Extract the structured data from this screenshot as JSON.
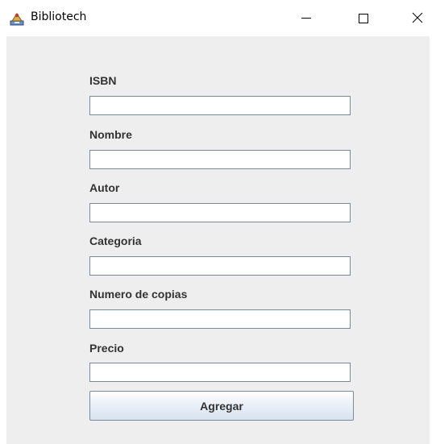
{
  "window": {
    "title": "Bibliotech",
    "icons": {
      "app": "java-app-icon",
      "minimize": "minimize-icon",
      "maximize": "maximize-icon",
      "close": "close-icon"
    }
  },
  "form": {
    "fields": [
      {
        "label": "ISBN",
        "value": ""
      },
      {
        "label": "Nombre",
        "value": ""
      },
      {
        "label": "Autor",
        "value": ""
      },
      {
        "label": "Categoria",
        "value": ""
      },
      {
        "label": "Numero de copias",
        "value": ""
      },
      {
        "label": "Precio",
        "value": ""
      }
    ],
    "submit_label": "Agregar"
  },
  "colors": {
    "panel_background": "#eeeeee",
    "label_text": "#333333",
    "field_border": "#7a8a99"
  }
}
